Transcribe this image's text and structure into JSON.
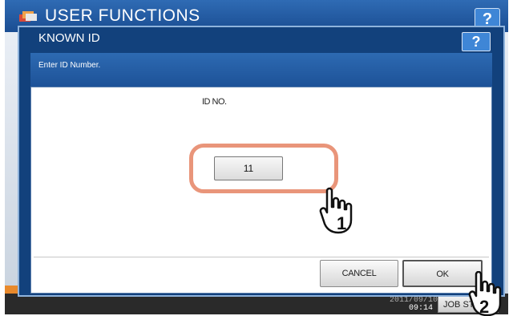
{
  "background": {
    "title": "USER FUNCTIONS",
    "help_label": "?",
    "clock_date": "2011/09/10",
    "clock_time": "09:14",
    "job_status_label": "JOB STATUS"
  },
  "dialog": {
    "title": "KNOWN ID",
    "help_label": "?",
    "instruction": "Enter ID Number.",
    "id_label": "ID NO.",
    "id_value": "11",
    "cancel_label": "CANCEL",
    "ok_label": "OK"
  },
  "callouts": {
    "step1": "1",
    "step2": "2"
  },
  "colors": {
    "dialog_header": "#12417c",
    "instruction_bar": "#2d6ab2",
    "highlight": "#e9957a",
    "status_accent": "#e8892c"
  }
}
